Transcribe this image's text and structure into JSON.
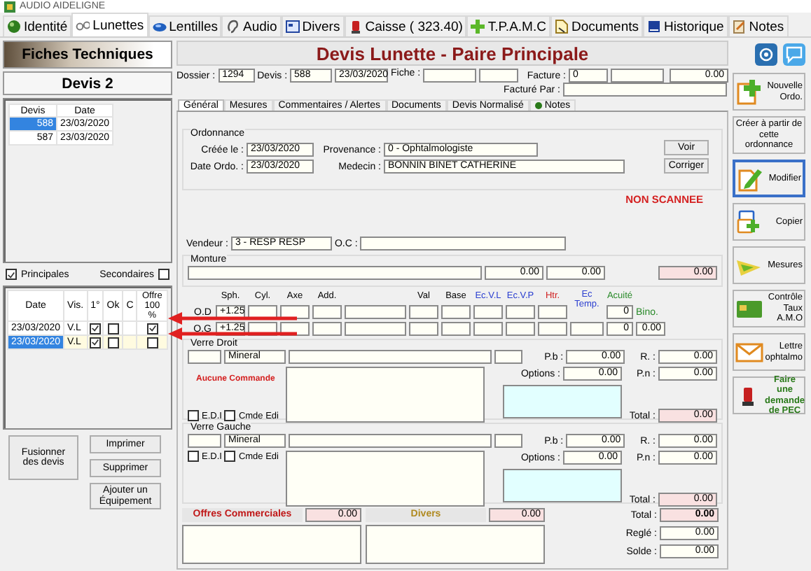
{
  "app_title": "AUDIO AIDELIGNE",
  "tabs": [
    {
      "label": "Identité",
      "selected": false
    },
    {
      "label": "Lunettes",
      "selected": true
    },
    {
      "label": "Lentilles",
      "selected": false
    },
    {
      "label": "Audio",
      "selected": false
    },
    {
      "label": "Divers",
      "selected": false
    },
    {
      "label": "Caisse ( 323.40)",
      "selected": false
    },
    {
      "label": "T.P.A.M.C",
      "selected": false
    },
    {
      "label": "Documents",
      "selected": false
    },
    {
      "label": "Historique",
      "selected": false
    },
    {
      "label": "Notes",
      "selected": false
    }
  ],
  "left_panel": {
    "header": "Fiches Techniques",
    "subtitle": "Devis 2",
    "devis_table": {
      "columns": [
        "Devis",
        "Date"
      ],
      "rows": [
        {
          "cells": [
            "588",
            "23/03/2020"
          ],
          "selected": true
        },
        {
          "cells": [
            "587",
            "23/03/2020"
          ],
          "selected": false
        }
      ]
    },
    "filters": [
      {
        "label": "Principales",
        "checked": true
      },
      {
        "label": "Secondaires",
        "checked": false
      }
    ],
    "pairs_table": {
      "columns": [
        "Date",
        "Vis.",
        "1°",
        "Ok",
        "C",
        "Offre 100 %"
      ],
      "rows": [
        {
          "date": "23/03/2020",
          "vision": "V.L",
          "first": true,
          "ok": false,
          "offre": true,
          "selected": false
        },
        {
          "date": "23/03/2020",
          "vision": "V.L",
          "first": true,
          "ok": false,
          "offre": false,
          "selected": true
        }
      ]
    },
    "buttons": [
      "Fusionner des devis",
      "Imprimer",
      "Supprimer",
      "Ajouter un Équipement"
    ]
  },
  "main": {
    "title": "Devis Lunette - Paire Principale",
    "dossier": {
      "label": "Dossier :",
      "value": "1294"
    },
    "devis": {
      "label": "Devis :",
      "number": "588",
      "date": "23/03/2020"
    },
    "fiche": {
      "label": "Fiche :"
    },
    "facture": {
      "label": "Facture :",
      "value": "0",
      "amount": "0.00"
    },
    "facture_par": {
      "label": "Facturé Par :"
    },
    "subtabs": [
      {
        "label": "Général",
        "selected": true
      },
      {
        "label": "Mesures",
        "selected": false
      },
      {
        "label": "Commentaires / Alertes",
        "selected": false
      },
      {
        "label": "Documents",
        "selected": false
      },
      {
        "label": "Devis Normalisé",
        "selected": false
      },
      {
        "label": "Notes",
        "selected": false
      }
    ],
    "ordonnance": {
      "title": "Ordonnance",
      "created_label": "Créée le :",
      "created": "23/03/2020",
      "date_label": "Date Ordo. :",
      "date": "23/03/2020",
      "provenance_label": "Provenance :",
      "provenance": "0 - Ophtalmologiste",
      "medecin_label": "Medecin :",
      "medecin": "BONNIN BINET CATHERINE",
      "buttons": [
        "Voir",
        "Corriger"
      ],
      "scan_status": "NON SCANNEE"
    },
    "vendeur": {
      "label": "Vendeur :",
      "value": "3 - RESP RESP"
    },
    "oc": {
      "label": "O.C :"
    },
    "monture": {
      "title": "Monture",
      "price_1": "0.00",
      "price_2": "0.00",
      "total": "0.00"
    },
    "prescription": {
      "columns": [
        {
          "label": "Sph.",
          "color": "#000000"
        },
        {
          "label": "Cyl.",
          "color": "#000000"
        },
        {
          "label": "Axe",
          "color": "#000000"
        },
        {
          "label": "Add.",
          "color": "#000000"
        },
        {
          "label": "Val",
          "color": "#000000"
        },
        {
          "label": "Base",
          "color": "#000000"
        },
        {
          "label": "Ec.V.L",
          "color": "#2b3fd0"
        },
        {
          "label": "Ec.V.P",
          "color": "#2b3fd0"
        },
        {
          "label": "Htr.",
          "color": "#d02020"
        },
        {
          "label": "Ec Temp.",
          "color": "#2b3fd0"
        },
        {
          "label": "Acuité",
          "color": "#2a8a2a"
        }
      ],
      "rows": [
        {
          "eye": "O.D",
          "sph": "+1.25",
          "acuite": "0"
        },
        {
          "eye": "O.G",
          "sph": "+1.25",
          "acuite": "0"
        }
      ],
      "bino_label": "Bino.",
      "bino": "0.00"
    },
    "lenses": [
      {
        "title": "Verre Droit",
        "material": "Mineral",
        "status": "Aucune Commande",
        "checks": [
          {
            "label": "E.D.I",
            "checked": false
          },
          {
            "label": "Cmde Edi",
            "checked": false
          }
        ],
        "pb_label": "P.b :",
        "pb": "0.00",
        "options_label": "Options :",
        "options": "0.00",
        "r_label": "R. :",
        "r": "0.00",
        "pn_label": "P.n :",
        "pn": "0.00",
        "total_label": "Total :",
        "total": "0.00"
      },
      {
        "title": "Verre Gauche",
        "material": "Mineral",
        "checks": [
          {
            "label": "E.D.I",
            "checked": false
          },
          {
            "label": "Cmde Edi",
            "checked": false
          }
        ],
        "pb_label": "P.b :",
        "pb": "0.00",
        "options_label": "Options :",
        "options": "0.00",
        "r_label": "R. :",
        "r": "0.00",
        "pn_label": "P.n :",
        "pn": "0.00",
        "total_label": "Total :",
        "total": "0.00"
      }
    ],
    "offres": {
      "label": "Offres Commerciales",
      "value": "0.00"
    },
    "divers": {
      "label": "Divers",
      "value": "0.00"
    },
    "totals": [
      {
        "label": "Total :",
        "value": "0.00"
      },
      {
        "label": "Reglé :",
        "value": "0.00"
      },
      {
        "label": "Solde :",
        "value": "0.00"
      }
    ]
  },
  "side_buttons": [
    {
      "label": "Nouvelle Ordo.",
      "focused": false
    },
    {
      "label": "Créer à partir de cette ordonnance",
      "focused": false
    },
    {
      "label": "Modifier",
      "focused": true
    },
    {
      "label": "Copier",
      "focused": false
    },
    {
      "label": "Mesures",
      "focused": false
    },
    {
      "label": "Contrôle Taux A.M.O",
      "focused": false
    },
    {
      "label": "Lettre ophtalmo",
      "focused": false
    },
    {
      "label": "Faire une demande de PEC",
      "focused": false
    }
  ]
}
